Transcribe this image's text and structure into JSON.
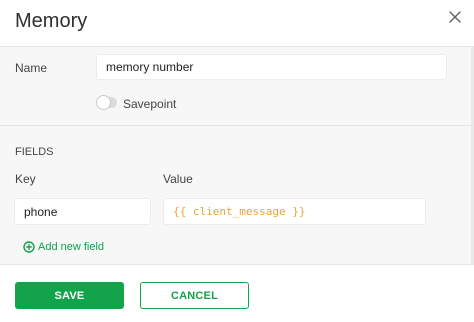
{
  "dialog": {
    "title": "Memory",
    "close_icon": "close-icon"
  },
  "form": {
    "name_label": "Name",
    "name_value": "memory number",
    "savepoint_label": "Savepoint",
    "savepoint_enabled": false,
    "fields_section_label": "FIELDS",
    "key_column_label": "Key",
    "value_column_label": "Value",
    "fields": [
      {
        "key": "phone",
        "value": "{{ client_message }}"
      }
    ],
    "add_field_label": "Add new field",
    "add_field_icon": "plus-circle-icon"
  },
  "footer": {
    "save_label": "SAVE",
    "cancel_label": "CANCEL"
  },
  "colors": {
    "accent": "#13a34a",
    "template_value": "#e8a43b",
    "panel_background": "#f7f7f7"
  }
}
